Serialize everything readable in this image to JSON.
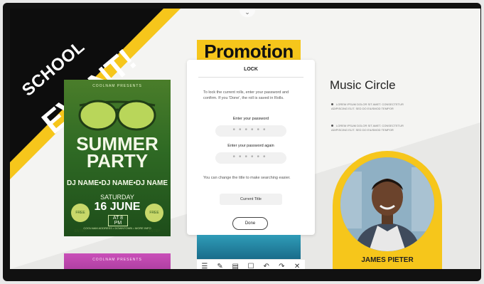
{
  "promotion_title": "Promotion",
  "event_banner": {
    "line1": "SCHOOL",
    "line2": "EVENT!"
  },
  "poster_summer": {
    "presents": "COOLNAM PRESENTS",
    "title_line1": "SUMMER",
    "title_line2": "PARTY",
    "dj_names": "DJ NAME•DJ NAME•DJ NAME",
    "day": "SATURDAY",
    "date": "16 JUNE",
    "time": "AT 8 PM",
    "badge_left": "FREE ENTRY",
    "badge_right": "FREE ENTRY",
    "footer": "COOLNAM ADDRESS • DOWNTOWN • MORE INFO"
  },
  "poster_pink": {
    "presents": "COOLNAM PRESENTS"
  },
  "lock_dialog": {
    "title": "LOCK",
    "description": "To lock the current rolls, enter your password and confirm. If you 'Done', the roll is saved in Rolls.",
    "password_label": "Enter your password",
    "password_again_label": "Enter your password again",
    "password_mask": "••••••",
    "hint": "You can change the title to make searching easier.",
    "current_title": "Current Title",
    "done_label": "Done"
  },
  "toolbar": {
    "icons": [
      "menu-icon",
      "pen-icon",
      "page-icon",
      "select-icon",
      "undo-icon",
      "redo-icon",
      "close-icon"
    ],
    "glyphs": [
      "☰",
      "✎",
      "▤",
      "☐",
      "↶",
      "↷",
      "✕"
    ]
  },
  "music_circle": {
    "title": "Music Circle",
    "bullets": [
      "LOREM IPSUM DOLOR SIT AMET. CONSECTETUR ADIPISCING ELIT. SED DO EIUSMOD TEMPOR",
      "LOREM IPSUM DOLOR SIT AMET. CONSECTETUR ADIPISCING ELIT. SED DO EIUSMOD TEMPOR"
    ]
  },
  "profile": {
    "name": "JAMES PIETER"
  },
  "colors": {
    "accent_yellow": "#f6c61b",
    "bezel": "#111111",
    "screen_bg": "#f0f0ee"
  }
}
